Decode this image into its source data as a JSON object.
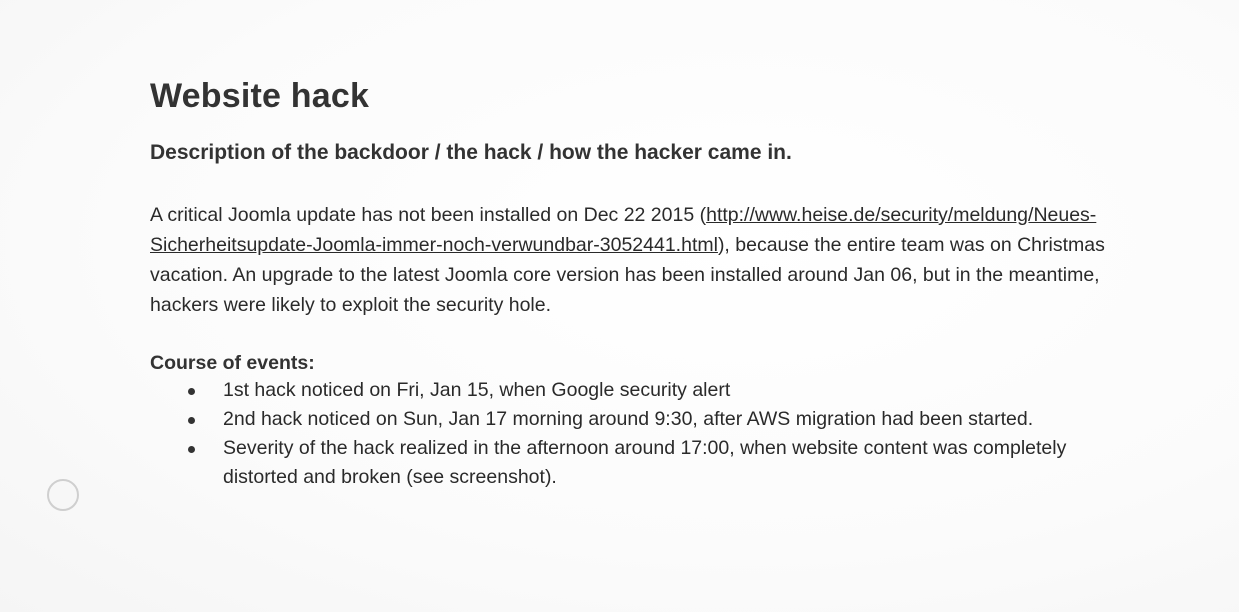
{
  "document": {
    "title": "Website hack",
    "subtitle": "Description of the backdoor / the hack / how the hacker came in.",
    "paragraph": {
      "before_link": "A critical Joomla update has not been installed on Dec 22 2015 (",
      "link_text": "http://www.heise.de/security/meldung/Neues-Sicherheitsupdate-Joomla-immer-noch-verwundbar-3052441.html",
      "after_link": "), because the entire team was on Christmas vacation. An upgrade to the latest Joomla core version has been installed around Jan 06, but in the meantime, hackers were likely to exploit the security hole."
    },
    "events_heading": "Course of events:",
    "events": [
      "1st hack noticed on Fri, Jan 15, when Google security alert",
      "2nd hack noticed on Sun, Jan 17 morning around 9:30, after AWS migration had been started.",
      "Severity of the hack realized in the afternoon around 17:00, when website content was completely distorted and broken (see screenshot)."
    ]
  }
}
